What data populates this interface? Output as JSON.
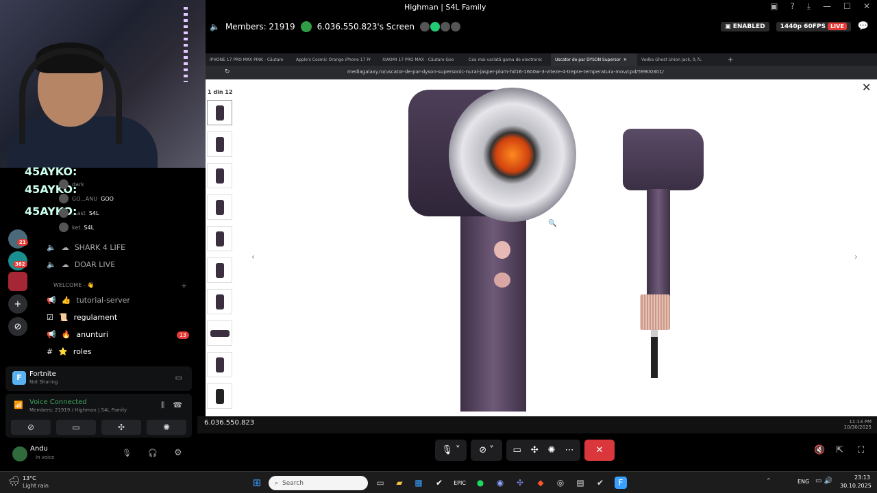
{
  "window": {
    "title": "Highman | S4L Family"
  },
  "stream": {
    "members": "Members: 21919",
    "screen_owner": "6.036.550.823's Screen",
    "enabled_label": "ENABLED",
    "quality": "1440p 60FPS",
    "live_label": "LIVE"
  },
  "browser": {
    "tabs": [
      {
        "label": "IPHONE 17 PRO MAX PINK - Căutare"
      },
      {
        "label": "Apple's Cosmic Orange iPhone 17 Pr"
      },
      {
        "label": "XIAOMI 17 PRO MAX - Căutare Goo"
      },
      {
        "label": "Cea mai variată gama de electronic"
      },
      {
        "label": "Uscator de par DYSON Supersor"
      },
      {
        "label": "Vodka Ghost Union Jack, 0,7L"
      }
    ],
    "url": "mediagalaxy.ro/uscator-de-par-dyson-supersonic-nural-jasper-plum-hd16-1600w-3-viteze-4-trepte-temperatura-mov/cpd/59900301/",
    "gallery_count": "1 din 12"
  },
  "stream_taskbar": {
    "amount": "6.036.550.823",
    "time": "11:13 PM",
    "date": "10/30/2025"
  },
  "sidebar": {
    "servers": [
      {
        "icon": "server-icon",
        "badge": "21"
      },
      {
        "icon": "server-icon",
        "badge": "382"
      }
    ],
    "voice_users": [
      {
        "name": "dark"
      },
      {
        "name": "GO...ANU",
        "tag": "GOO"
      },
      {
        "name": "...ast",
        "tag": "S4L"
      },
      {
        "name": "ket",
        "tag": "S4L"
      }
    ],
    "overlay_text": "45AYKO:",
    "channels": [
      {
        "label": "SHARK 4 LIFE"
      },
      {
        "label": "DOAR LIVE"
      }
    ],
    "category": "WELCOME - 👋",
    "text_channels": [
      {
        "label": "tutorial-server",
        "emoji": "👍"
      },
      {
        "label": "regulament",
        "emoji": "📜"
      },
      {
        "label": "anunturi",
        "emoji": "🔥",
        "badge": "13"
      },
      {
        "label": "roles",
        "emoji": "⭐"
      }
    ]
  },
  "activity": {
    "game": "Fortnite",
    "status": "Not Sharing"
  },
  "voice": {
    "status": "Voice Connected",
    "details": "Members: 21919 / Highman | S4L Family"
  },
  "user": {
    "name": "Andu",
    "status": "In voice"
  },
  "weather": {
    "temp": "13°C",
    "desc": "Light rain"
  },
  "taskbar": {
    "search_placeholder": "Search",
    "lang": "ENG",
    "time": "23:13",
    "date": "30.10.2025"
  }
}
